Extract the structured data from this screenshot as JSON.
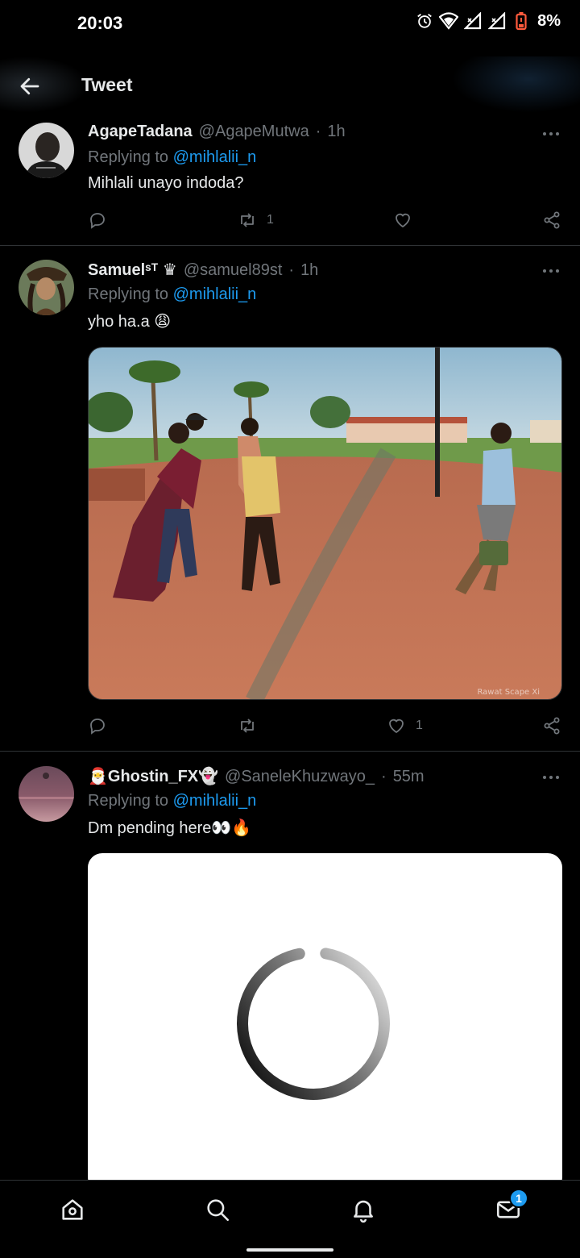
{
  "status_bar": {
    "time": "20:03",
    "battery": "8%"
  },
  "header": {
    "title": "Tweet"
  },
  "tweets": [
    {
      "name": "AgapeTadana",
      "handle": "@AgapeMutwa",
      "separator": "·",
      "time": "1h",
      "replying_prefix": "Replying to",
      "replying_to": "@mihlalii_n",
      "text": "Mihlali unayo indoda?",
      "retweets": "1",
      "likes": ""
    },
    {
      "name": "Samuelˢᵀ ♛",
      "handle": "@samuel89st",
      "separator": "·",
      "time": "1h",
      "replying_prefix": "Replying to",
      "replying_to": "@mihlalii_n",
      "text": "yho ha.a 😩",
      "retweets": "",
      "likes": "1",
      "media_watermark": "Rawat Scape Xi"
    },
    {
      "name": "🎅Ghostin_FX👻",
      "handle": "@SaneleKhuzwayo_",
      "separator": "·",
      "time": "55m",
      "replying_prefix": "Replying to",
      "replying_to": "@mihlalii_n",
      "text": "Dm pending here👀🔥"
    }
  ],
  "bottom_nav": {
    "items": [
      "home-icon",
      "search-icon",
      "notifications-icon",
      "messages-icon"
    ],
    "messages_badge": "1"
  },
  "colors": {
    "accent": "#1d9bf0",
    "background": "#000000",
    "muted": "#71767b",
    "text": "#e7e9ea"
  }
}
